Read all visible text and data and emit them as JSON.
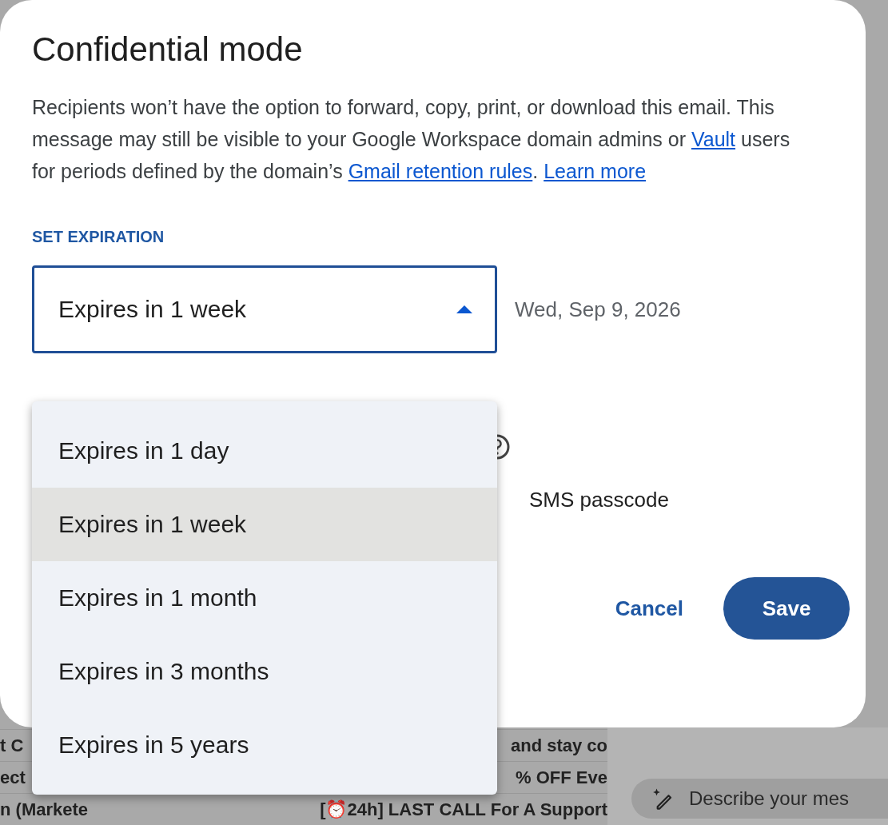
{
  "dialog": {
    "title": "Confidential mode",
    "description": [
      {
        "kind": "text",
        "text": "Recipients won’t have the option to forward, copy, print, or download this email. This message may still be visible to your Google Workspace domain admins or "
      },
      {
        "kind": "link",
        "text": "Vault"
      },
      {
        "kind": "text",
        "text": " users for periods defined by the domain’s "
      },
      {
        "kind": "link",
        "text": "Gmail retention rules"
      },
      {
        "kind": "text",
        "text": ". "
      },
      {
        "kind": "link",
        "text": "Learn more"
      }
    ],
    "expiration": {
      "label": "SET EXPIRATION",
      "value": "Expires in 1 week",
      "expanded": true,
      "date": "Wed, Sep 9, 2026",
      "options": [
        {
          "label": "Expires in 1 day",
          "selected": false
        },
        {
          "label": "Expires in 1 week",
          "selected": true
        },
        {
          "label": "Expires in 1 month",
          "selected": false
        },
        {
          "label": "Expires in 3 months",
          "selected": false
        },
        {
          "label": "Expires in 5 years",
          "selected": false
        }
      ]
    },
    "passcode_option": "SMS passcode",
    "buttons": [
      {
        "kind": "text",
        "label": "Cancel"
      },
      {
        "kind": "filled",
        "label": "Save"
      }
    ]
  },
  "inbox_rows": [
    {
      "sender": "t C",
      "subject": "and stay co"
    },
    {
      "sender": "ect",
      "subject": "% OFF Eve"
    },
    {
      "sender": "n (Markete",
      "subject": "[⏰24h] LAST CALL For A Support"
    }
  ],
  "side_panel": {
    "placeholder": "Describe your mes"
  }
}
